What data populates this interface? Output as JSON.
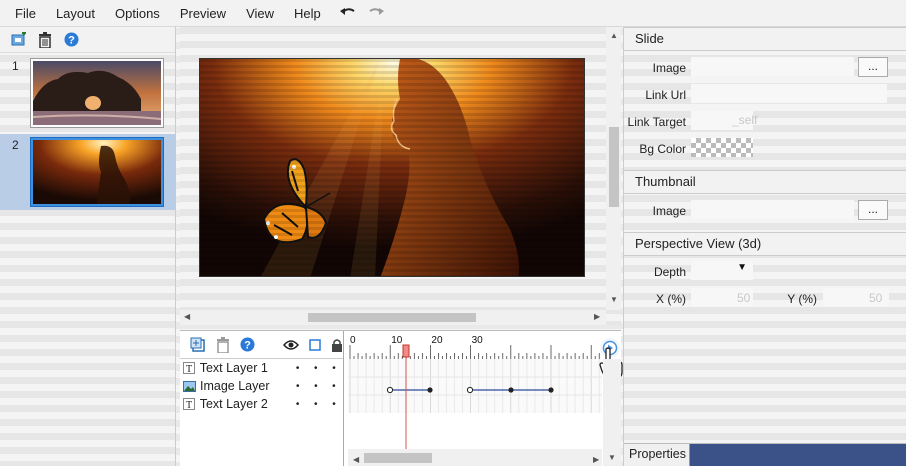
{
  "menu": {
    "items": [
      {
        "label": "File"
      },
      {
        "label": "Layout"
      },
      {
        "label": "Options"
      },
      {
        "label": "Preview"
      },
      {
        "label": "View"
      },
      {
        "label": "Help"
      }
    ]
  },
  "slides": {
    "items": [
      {
        "number": "1",
        "selected": false
      },
      {
        "number": "2",
        "selected": true
      }
    ]
  },
  "timeline": {
    "layers": [
      {
        "name": "Text Layer 1",
        "type": "text"
      },
      {
        "name": "Image Layer",
        "type": "image"
      },
      {
        "name": "Text Layer 2",
        "type": "text"
      }
    ],
    "ruler_labels": [
      "0",
      "10",
      "20",
      "30"
    ],
    "visibility_dot": "•"
  },
  "properties": {
    "slide": {
      "heading": "Slide",
      "image_label": "Image",
      "image_button": "...",
      "link_url_label": "Link Url",
      "link_target_label": "Link Target",
      "link_target_value": "_self",
      "bg_color_label": "Bg Color"
    },
    "thumbnail": {
      "heading": "Thumbnail",
      "image_label": "Image",
      "image_button": "..."
    },
    "perspective": {
      "heading": "Perspective View (3d)",
      "depth_label": "Depth",
      "x_label": "X (%)",
      "x_value": "50",
      "y_label": "Y (%)",
      "y_value": "50"
    },
    "footer_tab": "Properties"
  },
  "colors": {
    "selection": "#b9cde6",
    "accent_blue": "#3d8fe0",
    "footer_bar": "#3a5288",
    "playhead": "#d9534f"
  }
}
